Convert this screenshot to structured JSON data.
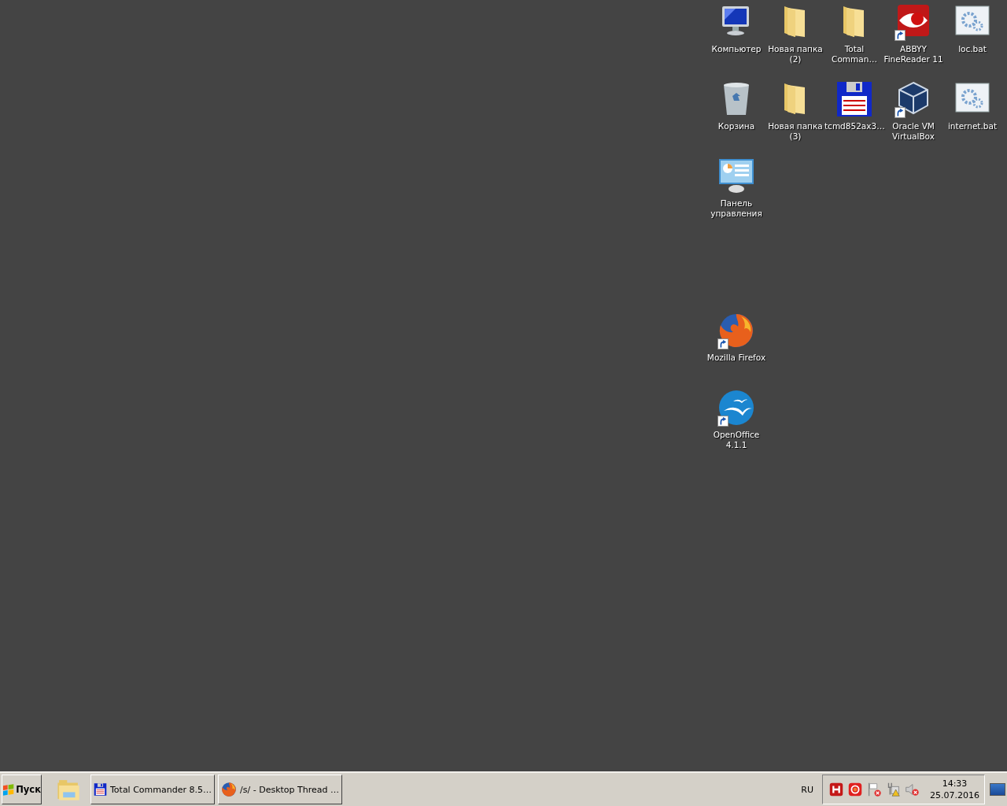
{
  "desktop_icons": [
    {
      "kind": "computer",
      "label": "Компьютер",
      "shortcut": false
    },
    {
      "kind": "folder",
      "label": "Новая папка (2)",
      "shortcut": false
    },
    {
      "kind": "folder",
      "label": "Total Comman…",
      "shortcut": false
    },
    {
      "kind": "eye",
      "label": "ABBYY FineReader 11",
      "shortcut": true
    },
    {
      "kind": "script",
      "label": "loc.bat",
      "shortcut": false
    },
    {
      "kind": "recycle-bin",
      "label": "Корзина",
      "shortcut": false
    },
    {
      "kind": "folder",
      "label": "Новая папка (3)",
      "shortcut": false
    },
    {
      "kind": "floppy",
      "label": "tcmd852ax3…",
      "shortcut": false
    },
    {
      "kind": "cube",
      "label": "Oracle VM VirtualBox",
      "shortcut": true
    },
    {
      "kind": "script",
      "label": "internet.bat",
      "shortcut": false
    },
    {
      "kind": "control-panel",
      "label": "Панель управления",
      "shortcut": false
    },
    {
      "kind": "firefox",
      "label": "Mozilla Firefox",
      "shortcut": true
    },
    {
      "kind": "openoffice",
      "label": "OpenOffice 4.1.1",
      "shortcut": true
    }
  ],
  "taskbar": {
    "start_label": "Пуск",
    "quick_launch": [
      {
        "kind": "folders"
      }
    ],
    "tasks": [
      {
        "kind": "floppy",
        "label": "Total Commander 8.5…"
      },
      {
        "kind": "firefox",
        "label": "/s/ - Desktop Thread …"
      }
    ],
    "language": "RU",
    "tray_icons": [
      {
        "kind": "h-app"
      },
      {
        "kind": "ring-app"
      },
      {
        "kind": "flag-error"
      },
      {
        "kind": "network-warning"
      },
      {
        "kind": "speaker-error"
      }
    ],
    "time": "14:33",
    "date": "25.07.2016"
  }
}
